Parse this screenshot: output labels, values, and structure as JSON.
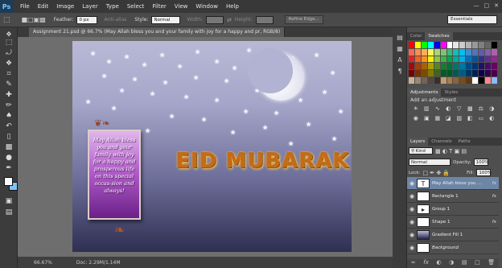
{
  "menu": {
    "logo": "Ps",
    "items": [
      "File",
      "Edit",
      "Image",
      "Layer",
      "Type",
      "Select",
      "Filter",
      "View",
      "Window",
      "Help"
    ]
  },
  "options": {
    "feather_label": "Feather:",
    "feather_value": "0 px",
    "antialias_label": "Anti-alias",
    "style_label": "Style:",
    "style_value": "Normal",
    "width_label": "Width:",
    "height_label": "Height:",
    "refine_label": "Refine Edge...",
    "workspace": "Essentials"
  },
  "document": {
    "tab_title": "Assignment 21.psd @ 66.7% (May Allah bless you and your family with joy for a happy and pr, RGB/8)",
    "note_text": "May Allah bless you and your family with joy for a happy and prosperous life on this special occas-sion and always!",
    "headline": "EID MUBARAK"
  },
  "status": {
    "zoom": "66.67%",
    "doc_size": "Doc: 2.29M/1.14M"
  },
  "panels": {
    "color_tab": "Color",
    "swatches_tab": "Swatches",
    "adjustments_tab": "Adjustments",
    "styles_tab": "Styles",
    "add_adjustment": "Add an adjustment",
    "layers_tab": "Layers",
    "channels_tab": "Channels",
    "paths_tab": "Paths",
    "kind_label": "Kind",
    "blend_mode": "Normal",
    "opacity_label": "Opacity:",
    "opacity_value": "100%",
    "lock_label": "Lock:",
    "fill_label": "Fill:",
    "fill_value": "100%"
  },
  "layers": [
    {
      "name": "May Allah bless you ...",
      "fx": "fx",
      "selected": true,
      "thumb": "T"
    },
    {
      "name": "Rectangle 1",
      "fx": "fx",
      "selected": false,
      "thumb": ""
    },
    {
      "name": "Group 1",
      "fx": "",
      "selected": false,
      "thumb": "▸"
    },
    {
      "name": "Shape 1",
      "fx": "fx",
      "selected": false,
      "thumb": ""
    },
    {
      "name": "Gradient Fill 1",
      "fx": "",
      "selected": false,
      "thumb": ""
    },
    {
      "name": "Background",
      "fx": "",
      "selected": false,
      "thumb": ""
    }
  ],
  "colors": {
    "foreground": "#ffffff",
    "background": "#7cc4f5",
    "selected_layer": "#6d86a6"
  }
}
